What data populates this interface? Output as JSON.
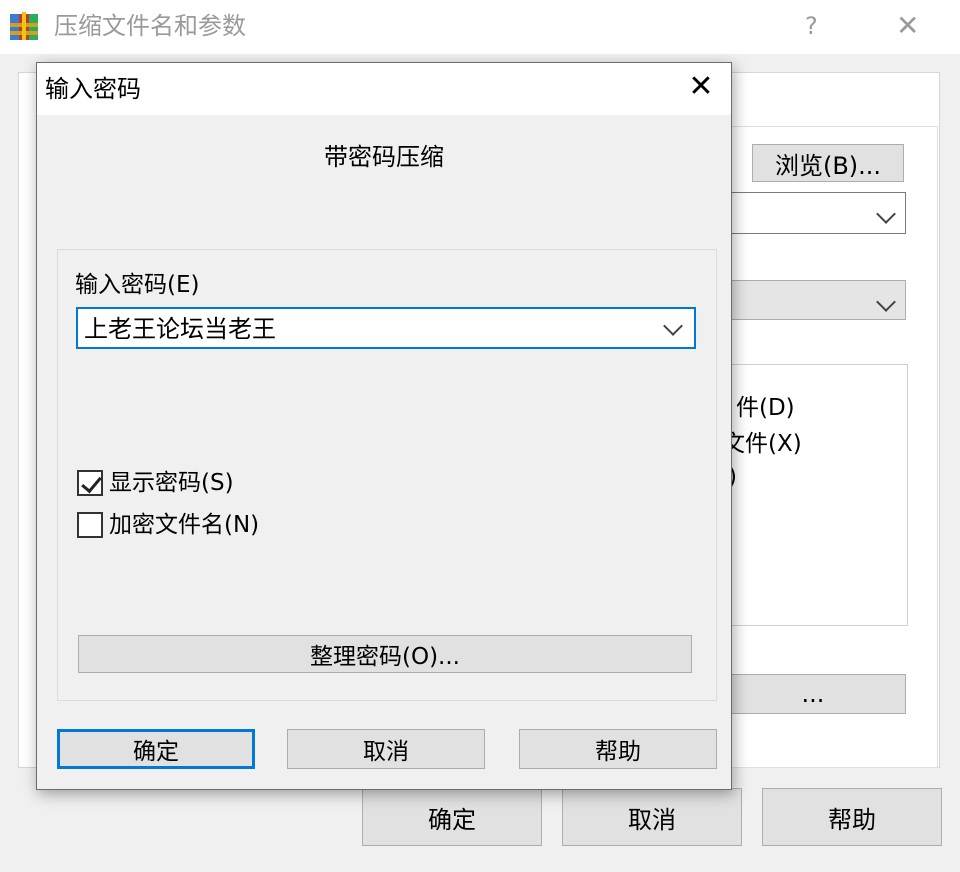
{
  "parent": {
    "title": "压缩文件名和参数",
    "help": "?",
    "close": "✕",
    "browse_button": "浏览(B)...",
    "option_1": "件(D)",
    "option_2": "文件(X)",
    "option_3": ")",
    "partial_button": "...",
    "ok_button": "确定",
    "cancel_button": "取消",
    "help_button": "帮助"
  },
  "dialog": {
    "title": "输入密码",
    "close": "✕",
    "heading": "带密码压缩",
    "password_label": "输入密码(E)",
    "password_value": "上老王论坛当老王",
    "show_password_label": "显示密码(S)",
    "show_password_checked": true,
    "encrypt_names_label": "加密文件名(N)",
    "encrypt_names_checked": false,
    "organize_button": "整理密码(O)...",
    "ok_button": "确定",
    "cancel_button": "取消",
    "help_button": "帮助"
  },
  "colors": {
    "accent": "#0078d7",
    "button_face": "#e1e1e1",
    "dialog_bg": "#f0f0f0"
  }
}
